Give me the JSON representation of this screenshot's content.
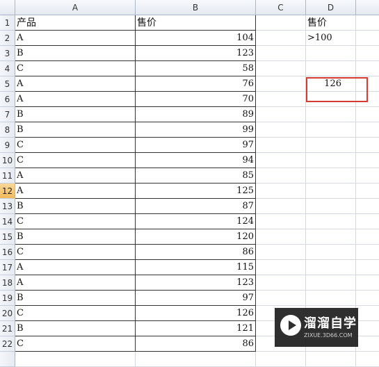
{
  "columns": [
    "A",
    "B",
    "C",
    "D"
  ],
  "active_row": "12",
  "header_row": {
    "A": "产品",
    "B": "售价",
    "D": "售价"
  },
  "criteria": {
    "D2": ">100"
  },
  "result": {
    "D5": "126"
  },
  "rows": [
    {
      "row": "2",
      "product": "A",
      "price": "104"
    },
    {
      "row": "3",
      "product": "B",
      "price": "123"
    },
    {
      "row": "4",
      "product": "C",
      "price": "58"
    },
    {
      "row": "5",
      "product": "A",
      "price": "76"
    },
    {
      "row": "6",
      "product": "A",
      "price": "70"
    },
    {
      "row": "7",
      "product": "B",
      "price": "89"
    },
    {
      "row": "8",
      "product": "B",
      "price": "99"
    },
    {
      "row": "9",
      "product": "C",
      "price": "97"
    },
    {
      "row": "10",
      "product": "C",
      "price": "94"
    },
    {
      "row": "11",
      "product": "A",
      "price": "85"
    },
    {
      "row": "12",
      "product": "A",
      "price": "125"
    },
    {
      "row": "13",
      "product": "B",
      "price": "87"
    },
    {
      "row": "14",
      "product": "C",
      "price": "124"
    },
    {
      "row": "15",
      "product": "B",
      "price": "120"
    },
    {
      "row": "16",
      "product": "C",
      "price": "86"
    },
    {
      "row": "17",
      "product": "A",
      "price": "115"
    },
    {
      "row": "18",
      "product": "A",
      "price": "123"
    },
    {
      "row": "19",
      "product": "B",
      "price": "97"
    },
    {
      "row": "20",
      "product": "C",
      "price": "126"
    },
    {
      "row": "21",
      "product": "B",
      "price": "121"
    },
    {
      "row": "22",
      "product": "C",
      "price": "86"
    }
  ],
  "watermark": {
    "title": "溜溜自学",
    "subtitle": "ZIXUE.3D66.COM",
    "icon": "play-icon"
  },
  "colors": {
    "highlight_box": "#d63b32",
    "active_row_header": "#f3b95a"
  }
}
